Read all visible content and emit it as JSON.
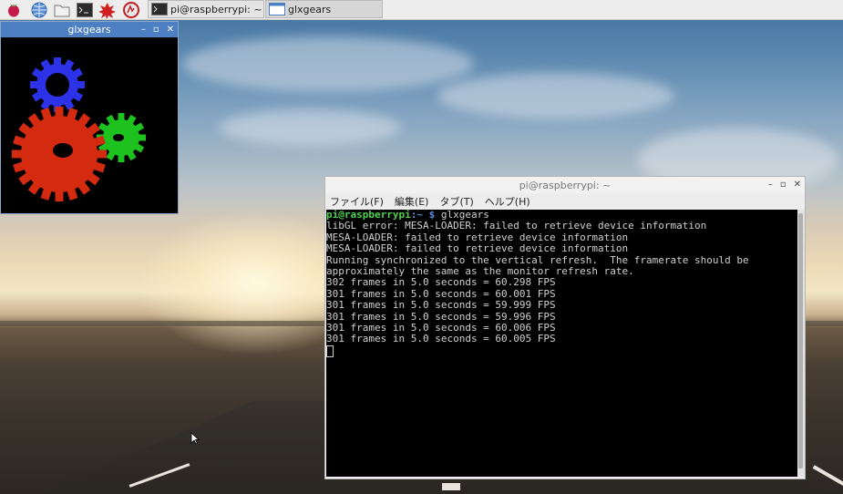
{
  "taskbar": {
    "launchers": [
      {
        "icon": "raspberry-menu-icon"
      },
      {
        "icon": "web-browser-icon"
      },
      {
        "icon": "file-manager-icon"
      },
      {
        "icon": "terminal-icon"
      },
      {
        "icon": "math-icon"
      },
      {
        "icon": "wolfram-icon"
      }
    ],
    "tasks": [
      {
        "label": "pi@raspberrypi: ~",
        "icon": "terminal-icon"
      },
      {
        "label": "glxgears",
        "icon": "window-icon"
      }
    ]
  },
  "gears_window": {
    "title": "glxgears",
    "controls": {
      "minimize": "–",
      "maximize": "▫",
      "close": "✕"
    },
    "gear_colors": {
      "red": "#d42a10",
      "green": "#1ec21e",
      "blue": "#2b32e8"
    }
  },
  "terminal": {
    "title": "pi@raspberrypi: ~",
    "controls": {
      "minimize": "–",
      "maximize": "▫",
      "close": "✕"
    },
    "menu": [
      "ファイル(F)",
      "編集(E)",
      "タブ(T)",
      "ヘルプ(H)"
    ],
    "prompt_user": "pi@raspberrypi",
    "prompt_path": ":~ $",
    "command": " glxgears",
    "output": [
      "libGL error: MESA-LOADER: failed to retrieve device information",
      "MESA-LOADER: failed to retrieve device information",
      "MESA-LOADER: failed to retrieve device information",
      "Running synchronized to the vertical refresh.  The framerate should be",
      "approximately the same as the monitor refresh rate.",
      "302 frames in 5.0 seconds = 60.298 FPS",
      "301 frames in 5.0 seconds = 60.001 FPS",
      "301 frames in 5.0 seconds = 59.999 FPS",
      "301 frames in 5.0 seconds = 59.996 FPS",
      "301 frames in 5.0 seconds = 60.006 FPS",
      "301 frames in 5.0 seconds = 60.005 FPS"
    ]
  }
}
